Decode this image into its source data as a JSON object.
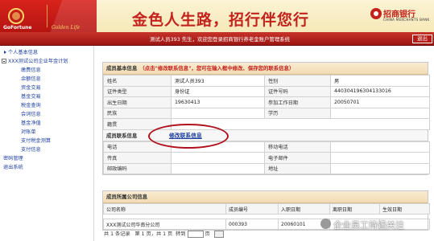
{
  "banner": {
    "brand_en": "GoFortune",
    "brand_sub": "Golden Life",
    "slogan": "金色人生路，招行伴您行",
    "bank_name": "招商银行",
    "bank_name_en": "CHINA MERCHANTS BANK",
    "brand_color": "#c4221c"
  },
  "welcome": {
    "text": "测试人员393 先生，欢迎您登录招商银行养老金账户管理系统",
    "logout": "退出"
  },
  "nav": {
    "items": [
      {
        "label": "个人基本信息",
        "type": "arrow"
      },
      {
        "label": "XXX测试公司企业年金计划",
        "type": "tree"
      },
      {
        "label": "缴费信息",
        "type": "child"
      },
      {
        "label": "余额信息",
        "type": "child"
      },
      {
        "label": "资金交易",
        "type": "child"
      },
      {
        "label": "基金交易",
        "type": "child"
      },
      {
        "label": "税金查询",
        "type": "child"
      },
      {
        "label": "会词信息",
        "type": "child"
      },
      {
        "label": "基金净值",
        "type": "child"
      },
      {
        "label": "对账单",
        "type": "child"
      },
      {
        "label": "支付税金测算",
        "type": "child"
      },
      {
        "label": "支付信息",
        "type": "child"
      },
      {
        "label": "密码管理",
        "type": "top"
      },
      {
        "label": "退出系统",
        "type": "top"
      }
    ]
  },
  "basic_info": {
    "title": "成员基本信息",
    "hint": "（点击\"修改联系信息\"，您可在输入框中修改、保存您的联系信息）",
    "rows": [
      {
        "l1": "姓名",
        "v1": "测试人员393",
        "l2": "性别",
        "v2": "男"
      },
      {
        "l1": "证件类型",
        "v1": "身份证",
        "l2": "证件号码",
        "v2": "440304196304133016"
      },
      {
        "l1": "出生日期",
        "v1": "19630413",
        "l2": "参加工作日期",
        "v2": "20050701"
      },
      {
        "l1": "民族",
        "v1": "",
        "l2": "学历",
        "v2": ""
      },
      {
        "l1": "籍贯",
        "v1": "",
        "l2": "",
        "v2": ""
      }
    ]
  },
  "contact": {
    "title": "成员联系信息",
    "edit_label": "修改联系信息",
    "rows": [
      {
        "l1": "电话",
        "v1": "",
        "l2": "移动电话",
        "v2": ""
      },
      {
        "l1": "传真",
        "v1": "",
        "l2": "电子邮件",
        "v2": ""
      },
      {
        "l1": "邮政编码",
        "v1": "",
        "l2": "地址",
        "v2": ""
      }
    ]
  },
  "company": {
    "title": "成员所属公司信息",
    "headers": [
      "公司名称",
      "成员编号",
      "入职日期",
      "离职日期",
      "生效日期"
    ],
    "rows": [
      [
        "XXX测试公司华南分公司",
        "000393",
        "20060101",
        "",
        ""
      ]
    ]
  },
  "pager": {
    "total": "共 1 条记录",
    "page": "第 1 页，共 1 页",
    "goto": "转到",
    "page_unit": "页"
  },
  "watermark": {
    "text": "企业员工待遇关注"
  }
}
